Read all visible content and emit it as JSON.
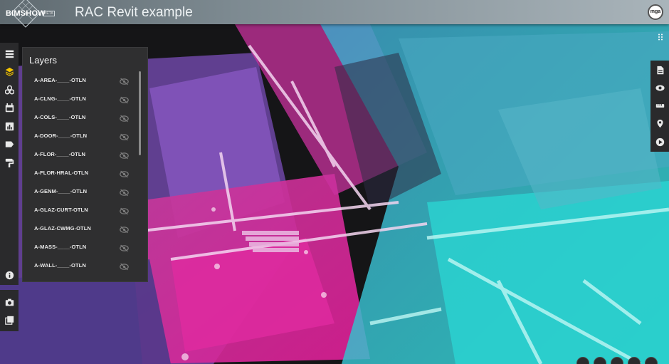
{
  "app": {
    "brand": "BIMSHOW",
    "beta_label": "BETA",
    "title": "RAC Revit example",
    "user_badge": "mga"
  },
  "left_toolbar": {
    "items": [
      {
        "icon": "list-icon"
      },
      {
        "icon": "layers-icon",
        "active": true
      },
      {
        "icon": "cubes-icon"
      },
      {
        "icon": "calendar-icon"
      },
      {
        "icon": "chart-icon"
      },
      {
        "icon": "tag-icon"
      },
      {
        "icon": "paint-roller-icon"
      },
      {
        "icon": "info-icon"
      }
    ],
    "bottom_items": [
      {
        "icon": "camera-icon"
      },
      {
        "icon": "gallery-icon"
      }
    ]
  },
  "layers_panel": {
    "title": "Layers",
    "layers": [
      {
        "name": "A-AREA-____-OTLN",
        "visible": false
      },
      {
        "name": "A-CLNG-____-OTLN",
        "visible": false
      },
      {
        "name": "A-COLS-____-OTLN",
        "visible": false
      },
      {
        "name": "A-DOOR-____-OTLN",
        "visible": false
      },
      {
        "name": "A-FLOR-____-OTLN",
        "visible": false
      },
      {
        "name": "A-FLOR-HRAL-OTLN",
        "visible": false
      },
      {
        "name": "A-GENM-____-OTLN",
        "visible": false
      },
      {
        "name": "A-GLAZ-CURT-OTLN",
        "visible": false
      },
      {
        "name": "A-GLAZ-CWMG-OTLN",
        "visible": false
      },
      {
        "name": "A-MASS-____-OTLN",
        "visible": false
      },
      {
        "name": "A-WALL-____-OTLN",
        "visible": false
      }
    ]
  },
  "right_toolbar": {
    "items": [
      {
        "icon": "document-icon"
      },
      {
        "icon": "eye-icon"
      },
      {
        "icon": "ruler-icon"
      },
      {
        "icon": "map-marker-icon"
      },
      {
        "icon": "play-icon"
      }
    ]
  },
  "colors": {
    "accent": "#f5c400",
    "magenta": "#d8329b",
    "cyan": "#28c9c9",
    "violet": "#7b4fb8"
  }
}
